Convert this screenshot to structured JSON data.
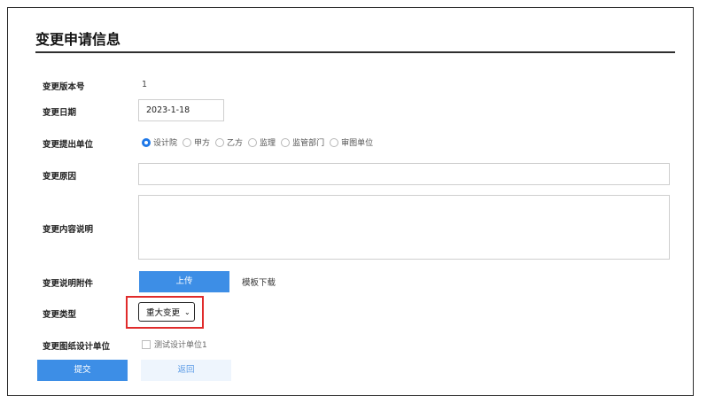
{
  "form": {
    "title": "变更申请信息",
    "version_label": "变更版本号",
    "version_value": "1",
    "date_label": "变更日期",
    "date_value": "2023-1-18",
    "proposer_label": "变更提出单位",
    "proposer_options": [
      "设计院",
      "甲方",
      "乙方",
      "监理",
      "监管部门",
      "审图单位"
    ],
    "proposer_selected": "设计院",
    "reason_label": "变更原因",
    "reason_value": "",
    "content_label": "变更内容说明",
    "content_value": "",
    "attachment_label": "变更说明附件",
    "upload_label": "上传",
    "template_download_label": "模板下载",
    "type_label": "变更类型",
    "type_selected": "重大变更",
    "design_unit_label": "变更图纸设计单位",
    "design_unit_option": "测试设计单位1",
    "design_unit_checked": false,
    "submit_label": "提交",
    "back_label": "返回"
  },
  "colors": {
    "primary": "#3d8ee6",
    "radio_selected": "#1e78e8",
    "highlight": "#e02b2b",
    "back_bg": "#eef5fd"
  }
}
